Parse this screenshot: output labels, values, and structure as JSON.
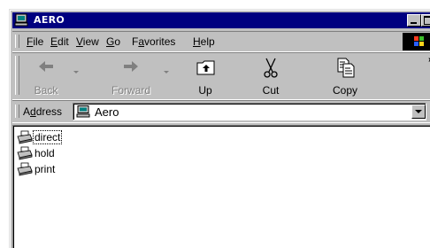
{
  "window": {
    "title": "AERO"
  },
  "menu": [
    {
      "pre": "",
      "acc": "F",
      "post": "ile"
    },
    {
      "pre": "",
      "acc": "E",
      "post": "dit"
    },
    {
      "pre": "",
      "acc": "V",
      "post": "iew"
    },
    {
      "pre": "",
      "acc": "G",
      "post": "o"
    },
    {
      "pre": "F",
      "acc": "a",
      "post": "vorites"
    },
    {
      "pre": "",
      "acc": "H",
      "post": "elp"
    }
  ],
  "toolbar": {
    "back": "Back",
    "forward": "Forward",
    "up": "Up",
    "cut": "Cut",
    "copy": "Copy",
    "more": "»"
  },
  "address": {
    "label_pre": "A",
    "label_acc": "d",
    "label_post": "dress",
    "value": "Aero"
  },
  "files": [
    {
      "name": "direct",
      "icon": "printer-icon",
      "focused": true
    },
    {
      "name": "hold",
      "icon": "printer-icon",
      "focused": false
    },
    {
      "name": "print",
      "icon": "printer-icon",
      "focused": false
    }
  ],
  "colors": {
    "titlebar": "#000080",
    "face": "#c0c0c0"
  }
}
